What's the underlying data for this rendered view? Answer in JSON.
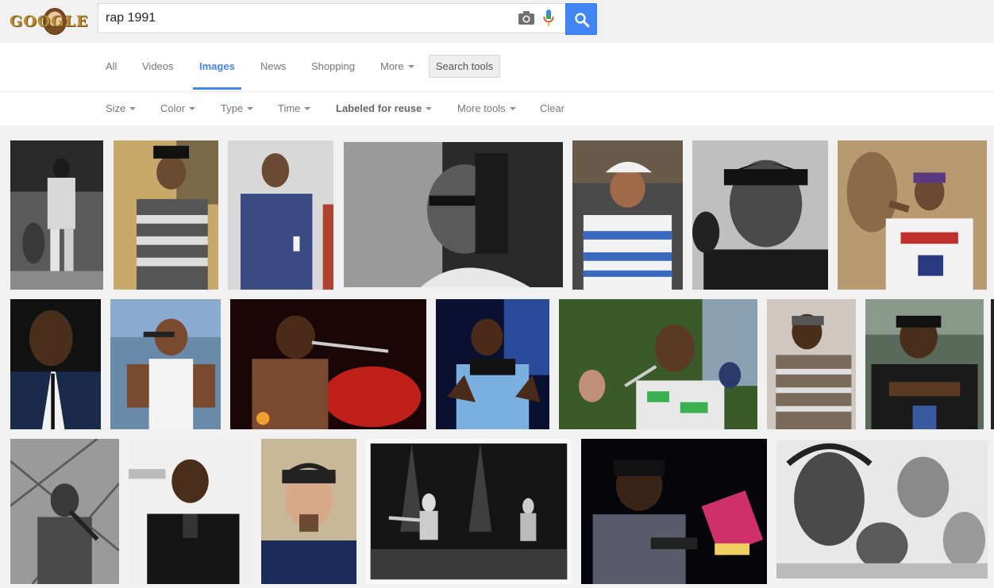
{
  "header": {
    "logo_text": "GOOGLE",
    "search_value": "rap 1991",
    "camera_icon": "camera-icon",
    "mic_icon": "microphone-icon",
    "search_icon": "magnifier-icon",
    "accent_color": "#4285f4"
  },
  "tabs": {
    "items": [
      "All",
      "Videos",
      "Images",
      "News",
      "Shopping",
      "More"
    ],
    "active": "Images",
    "search_tools_label": "Search tools"
  },
  "tools": {
    "size": "Size",
    "color": "Color",
    "type": "Type",
    "time": "Time",
    "labeled": "Labeled for reuse",
    "more_tools": "More tools",
    "clear": "Clear"
  },
  "results": {
    "row_count": 3,
    "image_count": 20
  }
}
